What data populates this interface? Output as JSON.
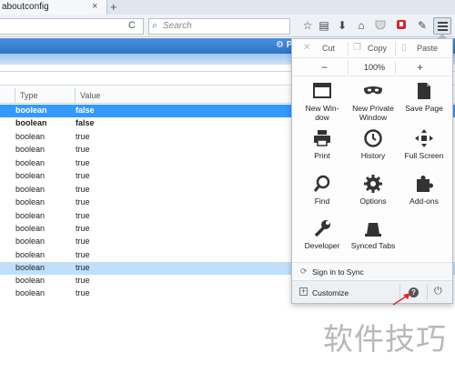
{
  "tab": {
    "title": "aboutconfig",
    "close_glyph": "×",
    "new_tab_glyph": "+"
  },
  "navbar": {
    "reload_glyph": "C",
    "search_placeholder": "Search",
    "icons": [
      "star-icon",
      "library-icon",
      "download-icon",
      "home-icon",
      "pocket-icon",
      "addon-red-icon",
      "sync-icon",
      "menu-icon"
    ]
  },
  "header": {
    "partial_label": "P"
  },
  "table": {
    "columns": [
      "Type",
      "Value"
    ],
    "rows": [
      {
        "type": "boolean",
        "value": "false",
        "state": "selected",
        "bold": true
      },
      {
        "type": "boolean",
        "value": "false",
        "state": "normal",
        "bold": true
      },
      {
        "type": "boolean",
        "value": "true",
        "state": "normal",
        "bold": false
      },
      {
        "type": "boolean",
        "value": "true",
        "state": "normal",
        "bold": false
      },
      {
        "type": "boolean",
        "value": "true",
        "state": "normal",
        "bold": false
      },
      {
        "type": "boolean",
        "value": "true",
        "state": "normal",
        "bold": false
      },
      {
        "type": "boolean",
        "value": "true",
        "state": "normal",
        "bold": false
      },
      {
        "type": "boolean",
        "value": "true",
        "state": "normal",
        "bold": false
      },
      {
        "type": "boolean",
        "value": "true",
        "state": "normal",
        "bold": false
      },
      {
        "type": "boolean",
        "value": "true",
        "state": "normal",
        "bold": false
      },
      {
        "type": "boolean",
        "value": "true",
        "state": "normal",
        "bold": false
      },
      {
        "type": "boolean",
        "value": "true",
        "state": "hover",
        "bold": false
      },
      {
        "type": "boolean",
        "value": "true",
        "state": "normal",
        "bold": false
      },
      {
        "type": "boolean",
        "value": "true",
        "state": "normal",
        "bold": false
      }
    ]
  },
  "menu": {
    "edit": {
      "cut": "Cut",
      "copy": "Copy",
      "paste": "Paste"
    },
    "zoom": {
      "minus": "−",
      "level": "100%",
      "plus": "+"
    },
    "items": [
      {
        "label": "New Win-\ndow",
        "icon": "new-window-icon"
      },
      {
        "label": "New Private\nWindow",
        "icon": "private-window-icon"
      },
      {
        "label": "Save Page",
        "icon": "save-page-icon"
      },
      {
        "label": "Print",
        "icon": "print-icon"
      },
      {
        "label": "History",
        "icon": "history-icon"
      },
      {
        "label": "Full Screen",
        "icon": "full-screen-icon"
      },
      {
        "label": "Find",
        "icon": "find-icon"
      },
      {
        "label": "Options",
        "icon": "options-icon"
      },
      {
        "label": "Add-ons",
        "icon": "addons-icon"
      },
      {
        "label": "Developer",
        "icon": "developer-icon"
      },
      {
        "label": "Synced Tabs",
        "icon": "synced-tabs-icon"
      }
    ],
    "sync_label": "Sign in to Sync",
    "customize_label": "Customize",
    "help_glyph": "?",
    "quit_glyph": "⏻"
  },
  "watermark": "软件技巧",
  "colors": {
    "selected_row": "#3399ff",
    "hover_row": "#bfe0fb",
    "header_blue": "#3a80d2",
    "annotation_arrow": "#e0282a"
  }
}
